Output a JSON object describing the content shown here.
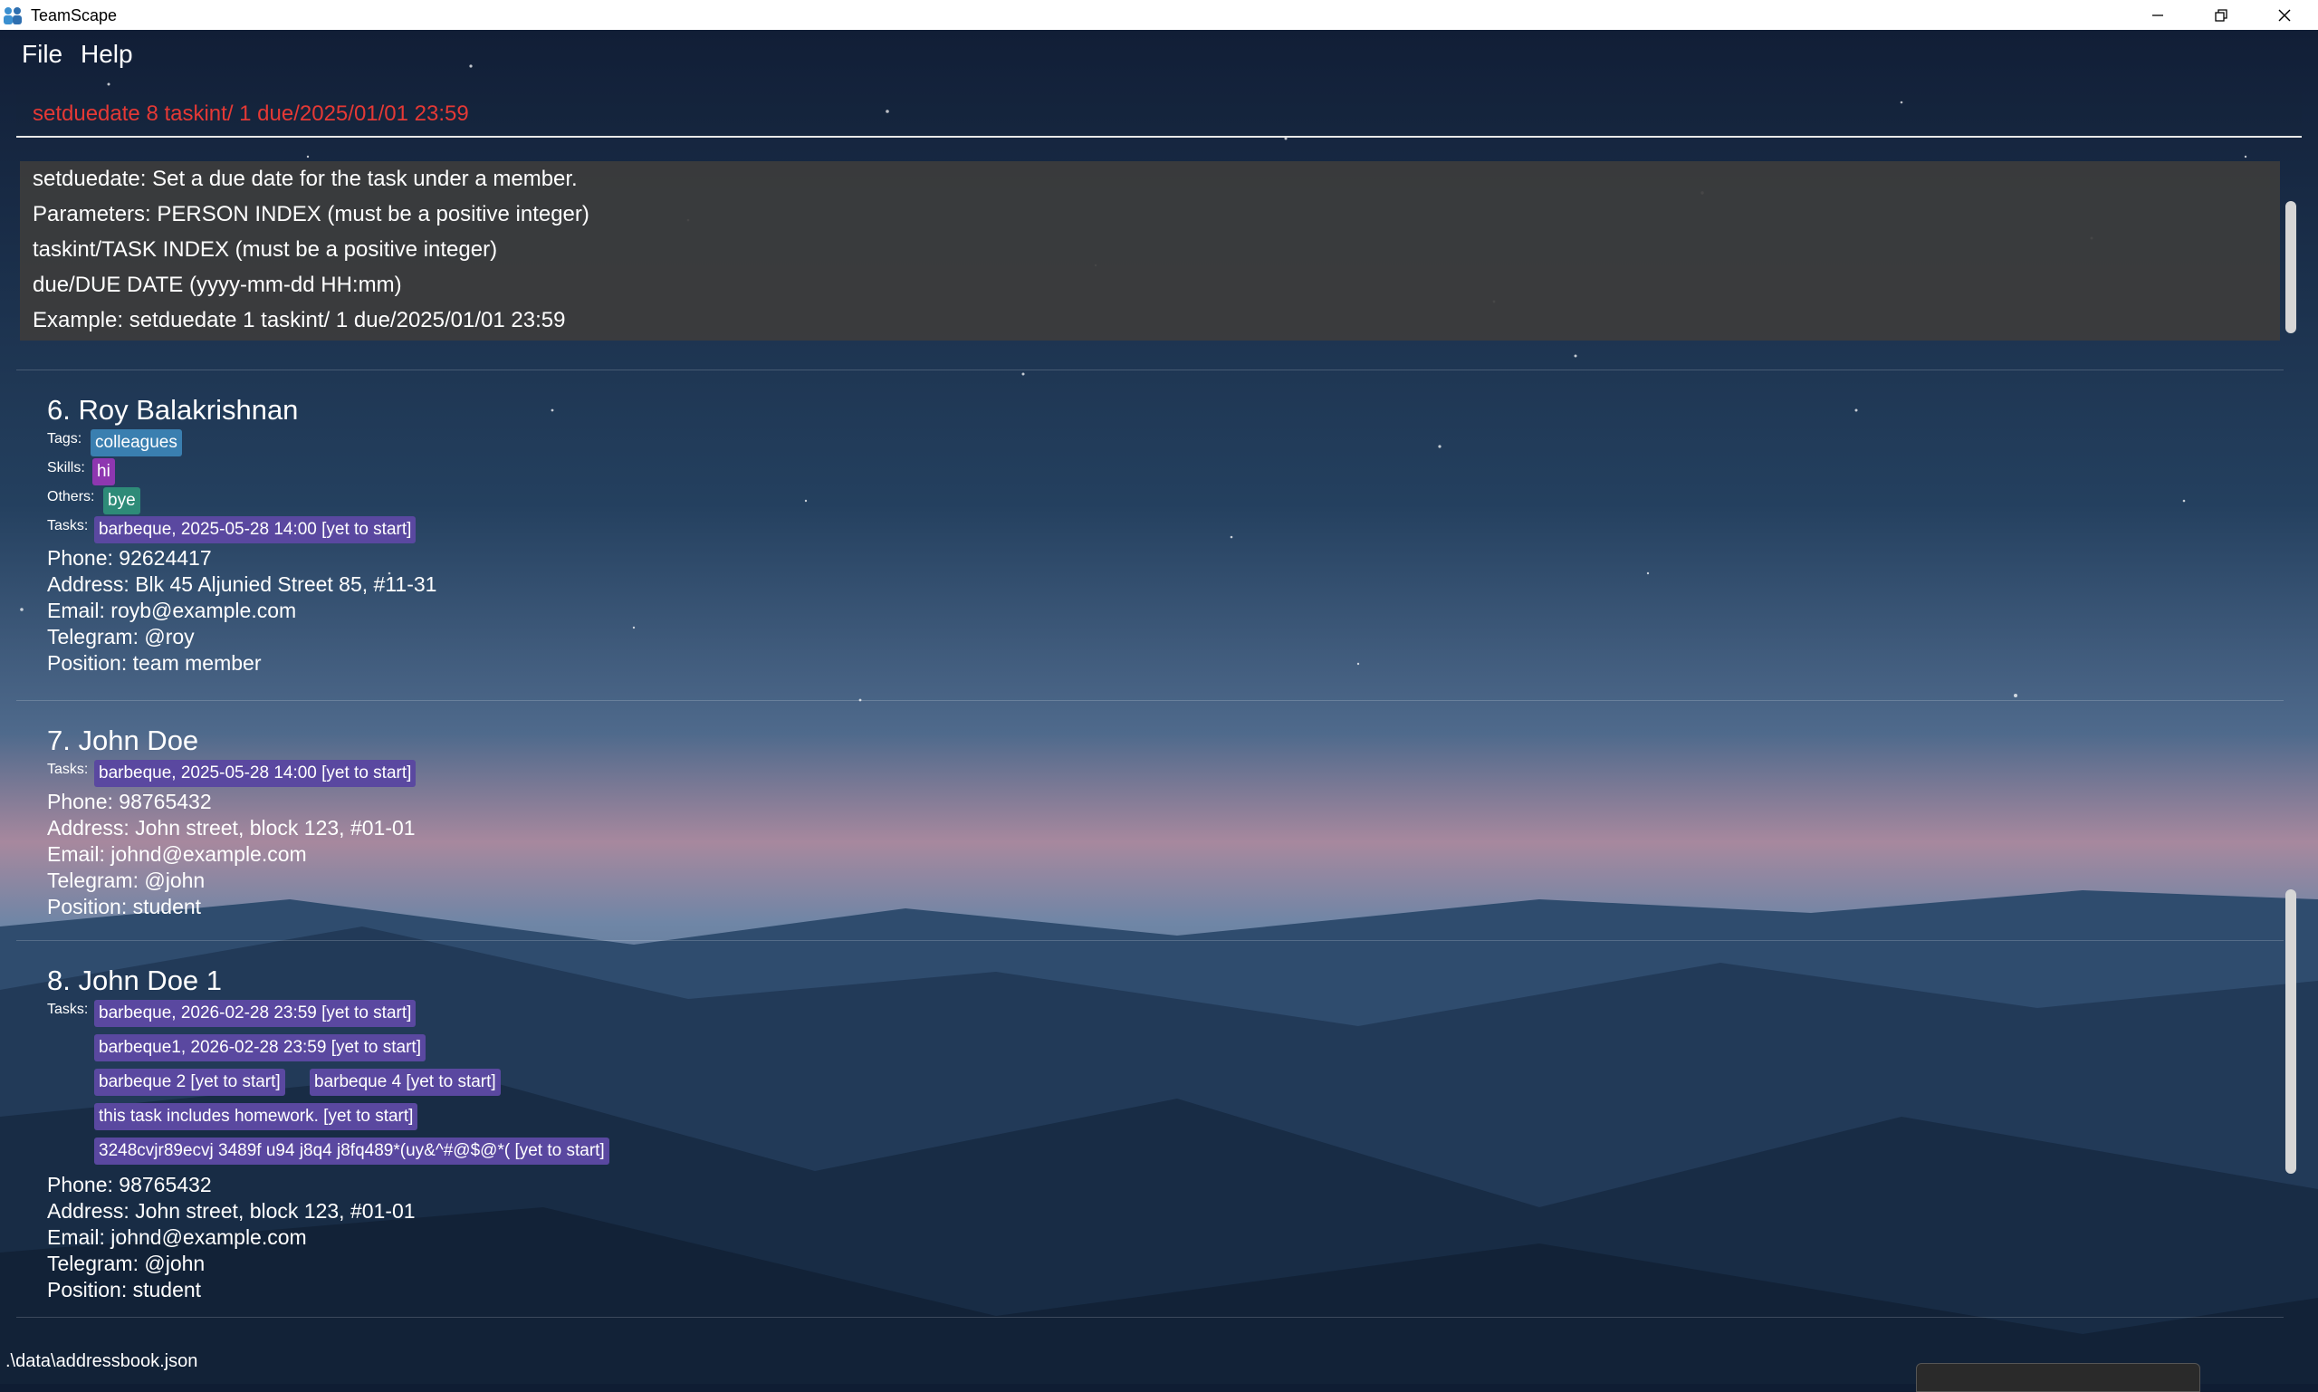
{
  "window": {
    "title": "TeamScape",
    "icon": "team-icon"
  },
  "menu": {
    "file": "File",
    "help": "Help"
  },
  "command": {
    "value": "setduedate 8 taskint/ 1 due/2025/01/01 23:59",
    "color": "#e53935"
  },
  "result": {
    "lines": [
      "setduedate: Set a due date for the task under a member.",
      "Parameters: PERSON INDEX (must be a positive integer)",
      "taskint/TASK INDEX (must be a positive integer)",
      "due/DUE DATE (yyyy-mm-dd HH:mm)",
      "Example: setduedate 1 taskint/ 1 due/2025/01/01 23:59"
    ]
  },
  "labels": {
    "tags": "Tags:",
    "skills": "Skills:",
    "others": "Others:",
    "tasks": "Tasks:"
  },
  "persons": [
    {
      "name": "6. Roy Balakrishnan",
      "tags": [
        "colleagues"
      ],
      "skills": [
        "hi"
      ],
      "others": [
        "bye"
      ],
      "tasks": [
        "barbeque, 2025-05-28 14:00 [yet to start]"
      ],
      "phone": "Phone: 92624417",
      "address": "Address: Blk 45 Aljunied Street 85, #11-31",
      "email": "Email: royb@example.com",
      "telegram": "Telegram: @roy",
      "position": "Position: team member"
    },
    {
      "name": "7. John Doe",
      "tasks": [
        "barbeque, 2025-05-28 14:00 [yet to start]"
      ],
      "phone": "Phone: 98765432",
      "address": "Address: John street, block 123, #01-01",
      "email": "Email: johnd@example.com",
      "telegram": "Telegram: @john",
      "position": "Position: student"
    },
    {
      "name": "8. John Doe 1",
      "tasks": [
        "barbeque, 2026-02-28 23:59 [yet to start]",
        "barbeque1, 2026-02-28 23:59 [yet to start]",
        "barbeque 2 [yet to start]",
        "barbeque 4 [yet to start]",
        "this task includes homework. [yet to start]",
        "3248cvjr89ecvj 3489f u94 j8q4 j8fq489*(uy&^#@$@*( [yet to start]"
      ],
      "phone": "Phone: 98765432",
      "address": "Address: John street, block 123, #01-01",
      "email": "Email: johnd@example.com",
      "telegram": "Telegram: @john",
      "position": "Position: student"
    }
  ],
  "status": {
    "file_path": ".\\data\\addressbook.json"
  },
  "colors": {
    "tag": "#3a7fb0",
    "skill": "#8e37b0",
    "other": "#2e8b78",
    "task": "#5a48a0"
  }
}
